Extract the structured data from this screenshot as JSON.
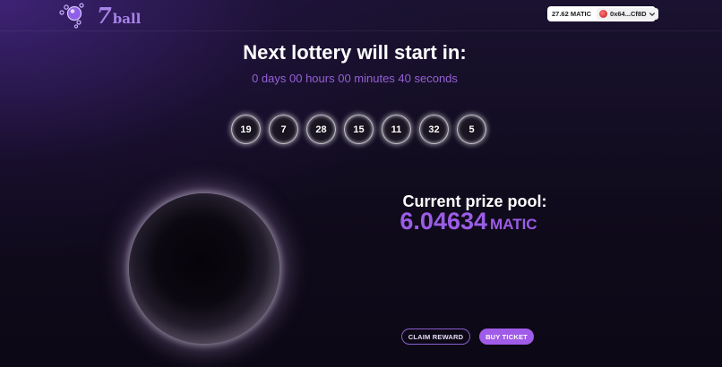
{
  "app": {
    "logo": {
      "number": "7",
      "word": "ball"
    }
  },
  "wallet": {
    "balance": "27.62 MATIC",
    "account": "0x64...Cf8D"
  },
  "lottery": {
    "headline": "Next lottery will start in:",
    "countdown": "0 days 00 hours 00 minutes 40 seconds",
    "numbers": [
      "19",
      "7",
      "28",
      "15",
      "11",
      "32",
      "5"
    ]
  },
  "prize": {
    "title": "Current prize pool:",
    "amount": "6.04634",
    "unit": "MATIC"
  },
  "actions": {
    "claim_label": "CLAIM REWARD",
    "buy_label": "BUY TICKET"
  },
  "colors": {
    "accent": "#a05be8",
    "countdown": "#9560d6",
    "background": "#0d0916"
  }
}
